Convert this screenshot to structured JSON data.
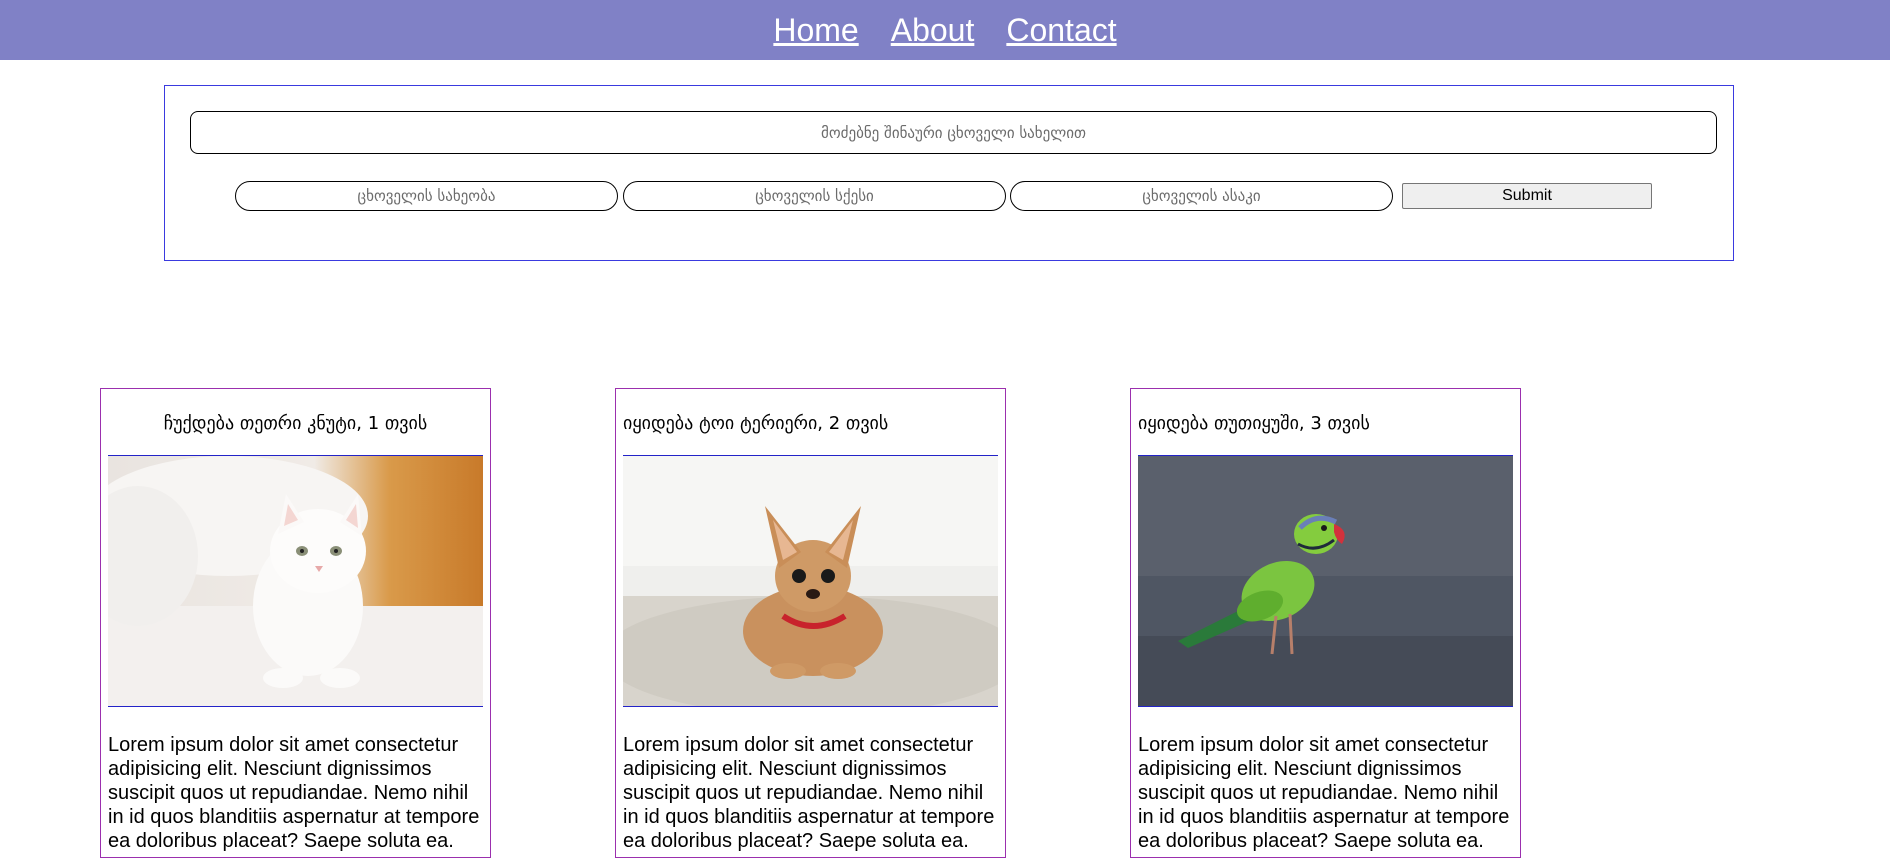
{
  "nav": {
    "links": [
      "Home",
      "About",
      "Contact"
    ]
  },
  "search": {
    "placeholder": "მოძებნე შინაური ცხოველი სახელით",
    "filters": {
      "species_placeholder": "ცხოველის სახეობა",
      "sex_placeholder": "ცხოველის სქესი",
      "age_placeholder": "ცხოველის ასაკი"
    },
    "submit_label": "Submit"
  },
  "cards": [
    {
      "title": "ჩუქდება თეთრი კნუტი, 1 თვის",
      "image": "white-kitten-image",
      "text": "Lorem ipsum dolor sit amet consectetur adipisicing elit. Nesciunt dignissimos suscipit quos ut repudiandae. Nemo nihil in id quos blanditiis aspernatur at tempore ea doloribus placeat? Saepe soluta ea."
    },
    {
      "title": "იყიდება ტოი ტერიერი, 2 თვის",
      "image": "toy-terrier-image",
      "text": "Lorem ipsum dolor sit amet consectetur adipisicing elit. Nesciunt dignissimos suscipit quos ut repudiandae. Nemo nihil in id quos blanditiis aspernatur at tempore ea doloribus placeat? Saepe soluta ea."
    },
    {
      "title": "იყიდება თუთიყუში, 3 თვის",
      "image": "green-parrot-image",
      "text": "Lorem ipsum dolor sit amet consectetur adipisicing elit. Nesciunt dignissimos suscipit quos ut repudiandae. Nemo nihil in id quos blanditiis aspernatur at tempore ea doloribus placeat? Saepe soluta ea."
    }
  ],
  "colors": {
    "navbar": "#8081c6",
    "search_border": "#3a3adf",
    "card_border": "#9b2fae",
    "image_border": "#2323c8"
  }
}
